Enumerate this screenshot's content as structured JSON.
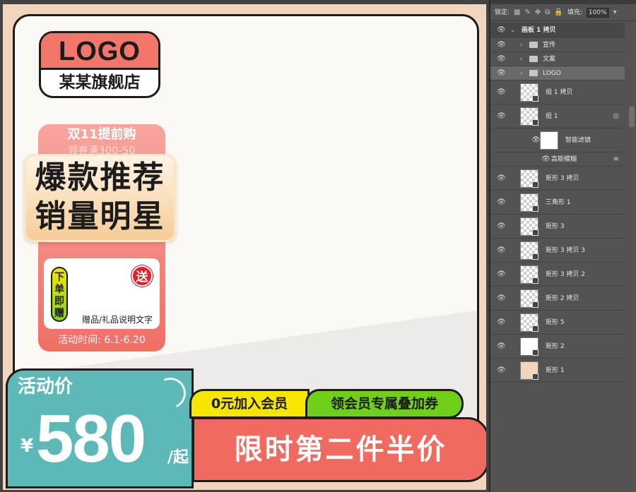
{
  "artwork": {
    "logo_text": "LOGO",
    "store_name": "某某旗舰店",
    "promo_title": "双11提前购",
    "promo_coupon": "领券满300-50",
    "headline_line1": "爆款推荐",
    "headline_line2": "销量明星",
    "gift_pill_chars": [
      "下",
      "单",
      "即",
      "赠"
    ],
    "gift_badge": "送",
    "gift_note": "赠品/礼品说明文字",
    "promo_time": "活动时间: 6.1-6.20",
    "price_label": "活动价",
    "price_currency": "¥",
    "price_value": "580",
    "price_unit": "/起",
    "badge_member": "0元加入会员",
    "badge_coupon": "领会员专属叠加券",
    "promo_banner": "限时第二件半价"
  },
  "colors": {
    "artboard_bg": "#f2d5bd",
    "coral": "#f16a5f",
    "teal": "#5cb9b7",
    "yellow": "#f7e600",
    "green": "#70cf19"
  },
  "layers_panel": {
    "lock_label": "锁定:",
    "fill_label": "填充:",
    "fill_value": "100%",
    "icons": [
      "eye-icon",
      "folder-icon",
      "lock-icon",
      "smart-filter-icon"
    ],
    "layers": [
      {
        "name": "画板 1 拷贝",
        "kind": "artboard"
      },
      {
        "name": "宣传",
        "kind": "folder"
      },
      {
        "name": "文案",
        "kind": "folder"
      },
      {
        "name": "LOGO",
        "kind": "folder",
        "selected": true
      },
      {
        "name": "组 1 拷贝",
        "kind": "layer"
      },
      {
        "name": "组 1",
        "kind": "layer"
      },
      {
        "name": "智能滤镜",
        "kind": "filter"
      },
      {
        "name": "高斯模糊",
        "kind": "filter-item"
      },
      {
        "name": "矩形 3 拷贝",
        "kind": "layer"
      },
      {
        "name": "三角形 1",
        "kind": "layer"
      },
      {
        "name": "矩形 3",
        "kind": "layer"
      },
      {
        "name": "矩形 3 拷贝 3",
        "kind": "layer"
      },
      {
        "name": "矩形 3 拷贝 2",
        "kind": "layer"
      },
      {
        "name": "矩形 2 拷贝",
        "kind": "layer"
      },
      {
        "name": "矩形 5",
        "kind": "layer"
      },
      {
        "name": "矩形 2",
        "kind": "layer"
      },
      {
        "name": "矩形 1",
        "kind": "layer"
      }
    ]
  }
}
